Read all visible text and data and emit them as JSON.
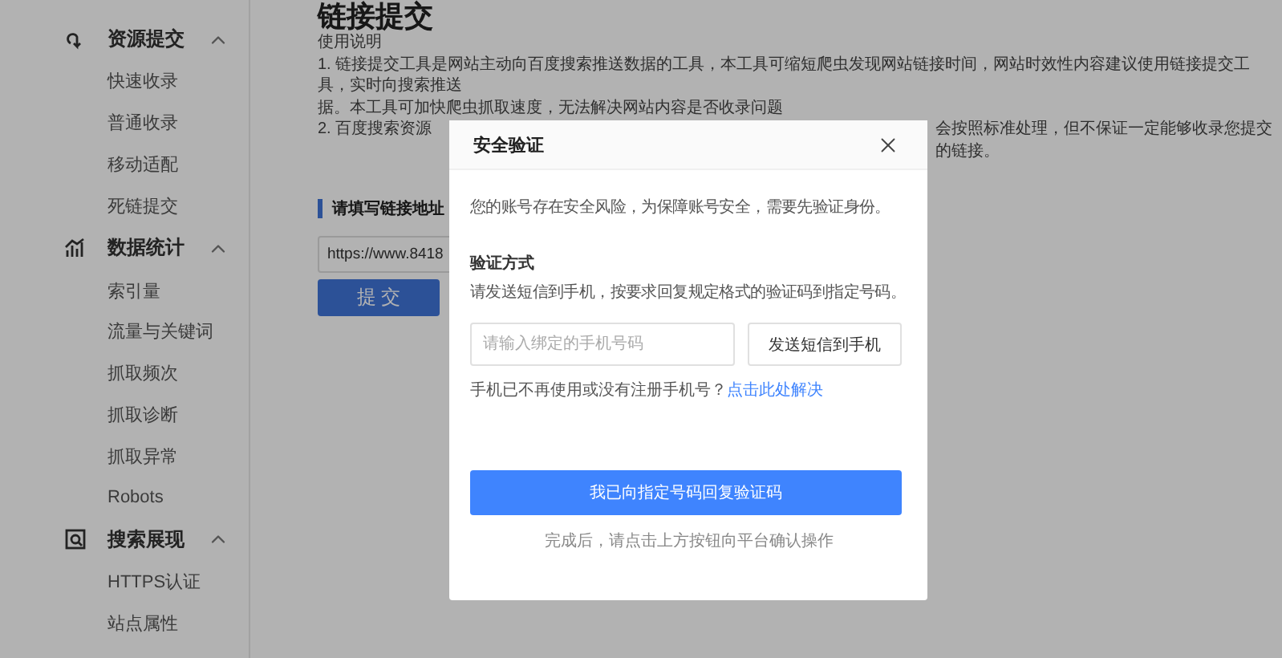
{
  "sidebar": {
    "groups": [
      {
        "label": "资源提交",
        "expanded": true,
        "children": [
          "快速收录",
          "普通收录",
          "移动适配",
          "死链提交"
        ]
      },
      {
        "label": "数据统计",
        "expanded": true,
        "children": [
          "索引量",
          "流量与关键词",
          "抓取频次",
          "抓取诊断",
          "抓取异常",
          "Robots"
        ]
      },
      {
        "label": "搜索展现",
        "expanded": true,
        "children": [
          "HTTPS认证",
          "站点属性"
        ]
      }
    ]
  },
  "main": {
    "title": "链接提交",
    "usage_heading": "使用说明",
    "usage_lines": [
      "1. 链接提交工具是网站主动向百度搜索推送数据的工具，本工具可缩短爬虫发现网站链接时间，网站时效性内容建议使用链接提交工具，实时向搜索推送",
      "据。本工具可加快爬虫抓取速度，无法解决网站内容是否收录问题"
    ],
    "usage_line_2_left": "2. 百度搜索资源",
    "usage_line_2_right": "会按照标准处理，但不保证一定能够收录您提交的链接。",
    "section_title": "请填写链接地址",
    "url_value": "https://www.8418",
    "submit_button": "提 交"
  },
  "dialog": {
    "title": "安全验证",
    "notice": "您的账号存在安全风险，为保障账号安全，需要先验证身份。",
    "method_heading": "验证方式",
    "method_text": "请发送短信到手机，按要求回复规定格式的验证码到指定号码。",
    "phone_placeholder": "请输入绑定的手机号码",
    "send_button": "发送短信到手机",
    "help_text": "手机已不再使用或没有注册手机号？",
    "help_link": "点击此处解决",
    "confirm_button": "我已向指定号码回复验证码",
    "footnote": "完成后，请点击上方按钮向平台确认操作"
  }
}
